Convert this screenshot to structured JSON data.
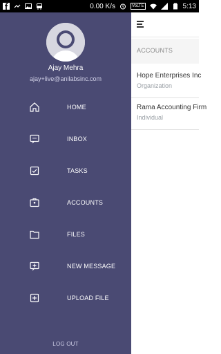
{
  "status_bar": {
    "left_icons": [
      "facebook-icon",
      "link-icon",
      "image-icon",
      "bus-icon"
    ],
    "speed": "0.00 K/s",
    "time": "5:13",
    "right_icons": [
      "alarm-icon",
      "volte-icon",
      "wifi-icon",
      "signal-icon",
      "battery-icon"
    ]
  },
  "drawer": {
    "user": {
      "name": "Ajay Mehra",
      "email": "ajay+live@anilabsinc.com"
    },
    "items": [
      {
        "label": "HOME",
        "icon": "home-icon"
      },
      {
        "label": "INBOX",
        "icon": "inbox-icon"
      },
      {
        "label": "TASKS",
        "icon": "tasks-icon"
      },
      {
        "label": "ACCOUNTS",
        "icon": "accounts-icon"
      },
      {
        "label": "FILES",
        "icon": "folder-icon"
      },
      {
        "label": "NEW MESSAGE",
        "icon": "new-message-icon"
      },
      {
        "label": "UPLOAD FILE",
        "icon": "upload-file-icon"
      }
    ],
    "logout": "LOG OUT",
    "colors": {
      "drawer_bg": "#4a4a73",
      "text": "#ffffff"
    }
  },
  "main": {
    "section_title": "ACCOUNTS",
    "accounts": [
      {
        "name": "Hope Enterprises Inc",
        "type": "Organization"
      },
      {
        "name": "Rama Accounting Firm",
        "type": "Individual"
      }
    ]
  }
}
